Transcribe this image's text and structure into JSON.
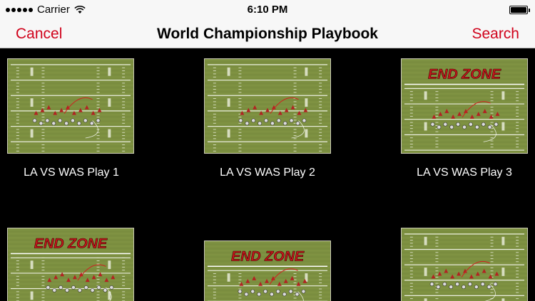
{
  "status": {
    "carrier": "Carrier",
    "time": "6:10 PM",
    "battery_level": 1.0
  },
  "nav": {
    "cancel_label": "Cancel",
    "title": "World Championship Playbook",
    "search_label": "Search"
  },
  "plays": [
    {
      "caption": "LA VS WAS Play 1",
      "end_zone_label": ""
    },
    {
      "caption": "LA VS WAS Play 2",
      "end_zone_label": ""
    },
    {
      "caption": "LA VS WAS Play 3",
      "end_zone_label": "END ZONE"
    },
    {
      "caption": "",
      "end_zone_label": "END ZONE"
    },
    {
      "caption": "",
      "end_zone_label": "END ZONE"
    },
    {
      "caption": "",
      "end_zone_label": ""
    }
  ],
  "colors": {
    "accent": "#d0021b",
    "field": "#7a8d3f",
    "end_zone_text": "#c4161c",
    "offense": "#b22222",
    "defense": "#dddddd"
  }
}
